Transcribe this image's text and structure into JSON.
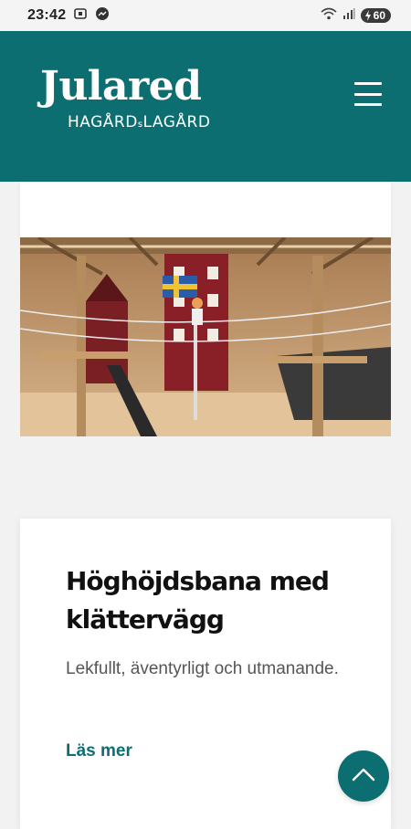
{
  "status_bar": {
    "time": "23:42",
    "battery": "60",
    "icons": [
      "screenshot-icon",
      "messenger-icon",
      "wifi-icon",
      "signal-icon",
      "battery-icon"
    ]
  },
  "header": {
    "logo_script": "Julared",
    "logo_sub_left": "HAGÅRD",
    "logo_sub_mid": "s",
    "logo_sub_right": "LAGÅRD",
    "menu_icon": "hamburger-menu-icon",
    "bg_color": "#0d6e71"
  },
  "card": {
    "title": "Höghöjdsbana med klättervägg",
    "description": "Lekfullt, äventyrligt och utmanande.",
    "link_label": "Läs mer",
    "accent_color": "#0d6e71"
  },
  "scroll_top": {
    "icon": "chevron-up-icon"
  }
}
